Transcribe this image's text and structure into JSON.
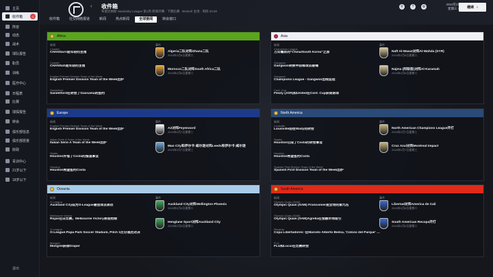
{
  "sidebar": {
    "items": [
      {
        "label": "主页",
        "icon": "home-icon"
      },
      {
        "label": "收件箱",
        "icon": "inbox-icon",
        "badge": "1"
      },
      {
        "label": "阵容",
        "icon": "squad-icon"
      },
      {
        "label": "动态",
        "icon": "dynamics-icon"
      },
      {
        "label": "战术",
        "icon": "tactics-icon"
      },
      {
        "label": "球队报告",
        "icon": "report-icon"
      },
      {
        "label": "职员",
        "icon": "staff-icon"
      },
      {
        "label": "训练",
        "icon": "training-icon"
      },
      {
        "label": "医疗中心",
        "icon": "medical-icon"
      },
      {
        "label": "日程表",
        "icon": "calendar-icon"
      },
      {
        "label": "比赛",
        "icon": "competitions-icon"
      },
      {
        "label": "球探报告",
        "icon": "scouting-icon"
      },
      {
        "label": "转会",
        "icon": "transfer-icon"
      },
      {
        "label": "俱乐部信息",
        "icon": "club-info-icon"
      },
      {
        "label": "俱乐部愿景",
        "icon": "vision-icon"
      },
      {
        "label": "财政",
        "icon": "finance-icon"
      },
      {
        "label": "青训中心",
        "icon": "youth-icon"
      },
      {
        "label": "21岁以下",
        "icon": "u21-icon"
      },
      {
        "label": "18岁以下",
        "icon": "u18-icon"
      }
    ],
    "bottom_label": "退出"
  },
  "header": {
    "title": "收件箱",
    "subtitle": "布雷达纳斯·Sandusky League 第1周·距离开赛 · 下期比赛 · Bestoril 主场 · 周四 20:00",
    "tabs": [
      "收件箱",
      "社交网络报道",
      "新闻",
      "热点新闻",
      "全球要闻",
      "转会窗口"
    ],
    "active_tab": 4,
    "date_line1": "2024年2月7日",
    "date_line2": "星期三 17:00",
    "continue_label": "继续",
    "icons": [
      "search-icon",
      "help-icon",
      "settings-icon"
    ]
  },
  "columns": {
    "news": "新闻",
    "events": "事件"
  },
  "panels": [
    {
      "name": "Africa",
      "color": "#5aa51d",
      "news": [
        {
          "sub": "Coaster",
          "main": "CHANSarri是年轻的主角"
        },
        {
          "sub": "Coaster",
          "main": "CHANSafi是年轻的主角"
        },
        {
          "sub": "English Premier Division Team of the Week",
          "main": "English Premier Division Team of the Week出炉"
        },
        {
          "sub": "Sandelford",
          "main": "Sandelford在转会了Gassama的签约"
        }
      ],
      "events": [
        {
          "title": "Algeria二队对阵Ghana二队",
          "date": "2024年2月6日星期二",
          "crest": "#e8a23a"
        },
        {
          "title": "Morocco二队对阵South Africa二队",
          "date": "2024年2月6日星期二",
          "crest": "#e8a23a"
        }
      ]
    },
    {
      "name": "Asia",
      "color": "#f0f0f4",
      "news": [
        {
          "sub": "Champions League",
          "main": "万众瞩目的\"China/South Korea\"之旅"
        },
        {
          "sub": "Gangwon",
          "main": "Gangwon转换中前锋球员被曝"
        },
        {
          "sub": "Gangwon",
          "main": "Champions League - Gangwon出线亚冠"
        },
        {
          "sub": "Conf. Cup",
          "main": "Fleaty (JOR)和United在Conf. Cup获得进球"
        }
      ],
      "events": [
        {
          "title": "Naft Al-Wasat对阵Al-Wahda (SYR)",
          "date": "2024年2月6日星期二",
          "crest": "#d7c9a0"
        },
        {
          "title": "Najma (阿联酋)对阵Al-Karamah",
          "date": "2024年2月6日星期二",
          "crest": "#d7c9a0"
        }
      ]
    },
    {
      "name": "Europe",
      "color": "#1d3a8a",
      "news": [
        {
          "sub": "English Premier Division Team of the Week",
          "main": "English Premier Division Team of the Week出炉"
        },
        {
          "sub": "Italian Serie A Team of the Week",
          "main": "Italian Serie A Team of the Week出炉"
        },
        {
          "sub": "Skater",
          "main": "Houston外借了Costa的报道事宜"
        },
        {
          "sub": "Houston",
          "main": "Houston希望签约Costa"
        }
      ],
      "events": [
        {
          "title": "AZ对阵Feyenoord",
          "date": "2024年2月7日星期三",
          "crest": "#ffffff"
        },
        {
          "title": "Man City和伊尔卡·威尔逊对阵Leeds和伊尔卡·威尔逊",
          "date": "2024年2月7日星期三",
          "crest": "#6cabdd"
        }
      ]
    },
    {
      "name": "North America",
      "color": "#2a4a78",
      "news": [
        {
          "sub": "Louisville",
          "main": "Louisville前往Wady的转会"
        },
        {
          "sub": "Skales",
          "main": "Houston已成了Costa的转会事宜"
        },
        {
          "sub": "Houston",
          "main": "Houston希望签约Costa"
        },
        {
          "sub": "Spanish First Division Team of the Week",
          "main": "Spanish First Division Team of the Week出炉"
        }
      ],
      "events": [
        {
          "title": "North American Champions League开打",
          "date": "2024年2月7日星期三",
          "crest": "#c9b57a"
        },
        {
          "title": "Cruz Azul对阵Montreal Impact",
          "date": "2024年2月7日星期三",
          "crest": "#c9b57a"
        }
      ]
    },
    {
      "name": "Oceania",
      "color": "#a8cce8",
      "news": [
        {
          "sub": "O-League",
          "main": "Auckland City成为O-League最佳球员表达"
        },
        {
          "sub": "Melbourne Victory",
          "main": "Rojas在日比赛，Melbourne Victory表现抢眼"
        },
        {
          "sub": "O-League",
          "main": "O-League:Papa Park Soccer Stadium, Pitch 1比分落后对决"
        },
        {
          "sub": "Mongrel",
          "main": "Mongrel获得Draper"
        }
      ],
      "events": [
        {
          "title": "Auckland City对阵Wellington Phoenix",
          "date": "2024年2月6日星期二",
          "crest": "#3fae5e"
        },
        {
          "title": "Henglane Sport对阵Auckland City",
          "date": "2024年2月6日星期二",
          "crest": "#3fae5e"
        }
      ]
    },
    {
      "name": "South America",
      "color": "#e02a1a",
      "news": [
        {
          "sub": "Olympic Quais (SAM)",
          "main": "Olympic Quais (SAM) Francismer是全场的第九名"
        },
        {
          "sub": "Olympic Quais (SAM)",
          "main": "Olympic Quais (SAM)Agrella在金融市场吸引"
        },
        {
          "sub": "Revanto",
          "main": "Copa Libertadores: 在Marcelo Alberto Bielsa, 'Coloso del Parque' 上..."
        },
        {
          "sub": "FLU",
          "main": "FLU和Lúcio在比赛转会"
        }
      ],
      "events": [
        {
          "title": "Libertad对阵America de Cali",
          "date": "2024年2月6日星期二",
          "crest": "#3a6ad8"
        },
        {
          "title": "South American Recopa开打",
          "date": "2024年2月6日星期二",
          "crest": "#3a6ad8"
        }
      ]
    }
  ]
}
